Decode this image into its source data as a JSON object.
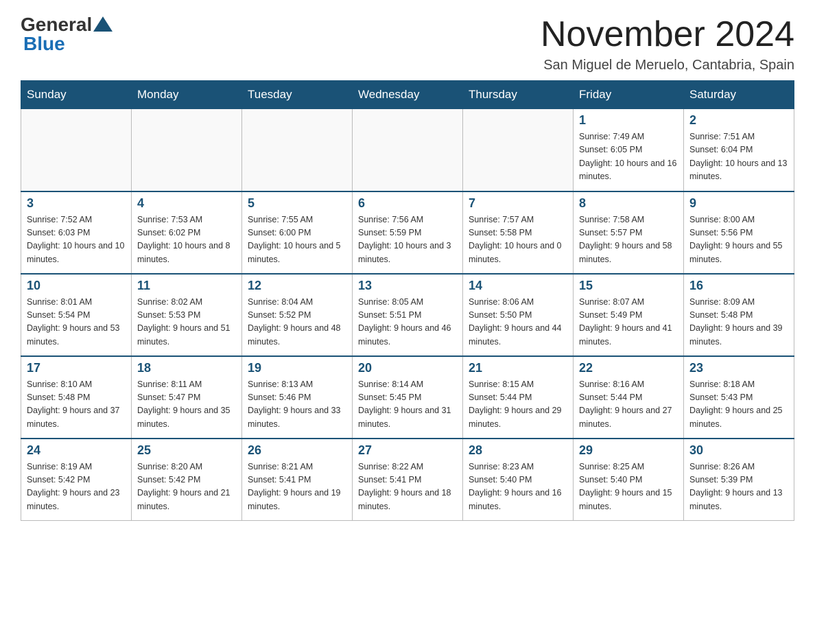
{
  "header": {
    "logo_general": "General",
    "logo_blue": "Blue",
    "month_title": "November 2024",
    "location": "San Miguel de Meruelo, Cantabria, Spain"
  },
  "weekdays": [
    "Sunday",
    "Monday",
    "Tuesday",
    "Wednesday",
    "Thursday",
    "Friday",
    "Saturday"
  ],
  "weeks": [
    [
      {
        "day": "",
        "info": ""
      },
      {
        "day": "",
        "info": ""
      },
      {
        "day": "",
        "info": ""
      },
      {
        "day": "",
        "info": ""
      },
      {
        "day": "",
        "info": ""
      },
      {
        "day": "1",
        "info": "Sunrise: 7:49 AM\nSunset: 6:05 PM\nDaylight: 10 hours and 16 minutes."
      },
      {
        "day": "2",
        "info": "Sunrise: 7:51 AM\nSunset: 6:04 PM\nDaylight: 10 hours and 13 minutes."
      }
    ],
    [
      {
        "day": "3",
        "info": "Sunrise: 7:52 AM\nSunset: 6:03 PM\nDaylight: 10 hours and 10 minutes."
      },
      {
        "day": "4",
        "info": "Sunrise: 7:53 AM\nSunset: 6:02 PM\nDaylight: 10 hours and 8 minutes."
      },
      {
        "day": "5",
        "info": "Sunrise: 7:55 AM\nSunset: 6:00 PM\nDaylight: 10 hours and 5 minutes."
      },
      {
        "day": "6",
        "info": "Sunrise: 7:56 AM\nSunset: 5:59 PM\nDaylight: 10 hours and 3 minutes."
      },
      {
        "day": "7",
        "info": "Sunrise: 7:57 AM\nSunset: 5:58 PM\nDaylight: 10 hours and 0 minutes."
      },
      {
        "day": "8",
        "info": "Sunrise: 7:58 AM\nSunset: 5:57 PM\nDaylight: 9 hours and 58 minutes."
      },
      {
        "day": "9",
        "info": "Sunrise: 8:00 AM\nSunset: 5:56 PM\nDaylight: 9 hours and 55 minutes."
      }
    ],
    [
      {
        "day": "10",
        "info": "Sunrise: 8:01 AM\nSunset: 5:54 PM\nDaylight: 9 hours and 53 minutes."
      },
      {
        "day": "11",
        "info": "Sunrise: 8:02 AM\nSunset: 5:53 PM\nDaylight: 9 hours and 51 minutes."
      },
      {
        "day": "12",
        "info": "Sunrise: 8:04 AM\nSunset: 5:52 PM\nDaylight: 9 hours and 48 minutes."
      },
      {
        "day": "13",
        "info": "Sunrise: 8:05 AM\nSunset: 5:51 PM\nDaylight: 9 hours and 46 minutes."
      },
      {
        "day": "14",
        "info": "Sunrise: 8:06 AM\nSunset: 5:50 PM\nDaylight: 9 hours and 44 minutes."
      },
      {
        "day": "15",
        "info": "Sunrise: 8:07 AM\nSunset: 5:49 PM\nDaylight: 9 hours and 41 minutes."
      },
      {
        "day": "16",
        "info": "Sunrise: 8:09 AM\nSunset: 5:48 PM\nDaylight: 9 hours and 39 minutes."
      }
    ],
    [
      {
        "day": "17",
        "info": "Sunrise: 8:10 AM\nSunset: 5:48 PM\nDaylight: 9 hours and 37 minutes."
      },
      {
        "day": "18",
        "info": "Sunrise: 8:11 AM\nSunset: 5:47 PM\nDaylight: 9 hours and 35 minutes."
      },
      {
        "day": "19",
        "info": "Sunrise: 8:13 AM\nSunset: 5:46 PM\nDaylight: 9 hours and 33 minutes."
      },
      {
        "day": "20",
        "info": "Sunrise: 8:14 AM\nSunset: 5:45 PM\nDaylight: 9 hours and 31 minutes."
      },
      {
        "day": "21",
        "info": "Sunrise: 8:15 AM\nSunset: 5:44 PM\nDaylight: 9 hours and 29 minutes."
      },
      {
        "day": "22",
        "info": "Sunrise: 8:16 AM\nSunset: 5:44 PM\nDaylight: 9 hours and 27 minutes."
      },
      {
        "day": "23",
        "info": "Sunrise: 8:18 AM\nSunset: 5:43 PM\nDaylight: 9 hours and 25 minutes."
      }
    ],
    [
      {
        "day": "24",
        "info": "Sunrise: 8:19 AM\nSunset: 5:42 PM\nDaylight: 9 hours and 23 minutes."
      },
      {
        "day": "25",
        "info": "Sunrise: 8:20 AM\nSunset: 5:42 PM\nDaylight: 9 hours and 21 minutes."
      },
      {
        "day": "26",
        "info": "Sunrise: 8:21 AM\nSunset: 5:41 PM\nDaylight: 9 hours and 19 minutes."
      },
      {
        "day": "27",
        "info": "Sunrise: 8:22 AM\nSunset: 5:41 PM\nDaylight: 9 hours and 18 minutes."
      },
      {
        "day": "28",
        "info": "Sunrise: 8:23 AM\nSunset: 5:40 PM\nDaylight: 9 hours and 16 minutes."
      },
      {
        "day": "29",
        "info": "Sunrise: 8:25 AM\nSunset: 5:40 PM\nDaylight: 9 hours and 15 minutes."
      },
      {
        "day": "30",
        "info": "Sunrise: 8:26 AM\nSunset: 5:39 PM\nDaylight: 9 hours and 13 minutes."
      }
    ]
  ]
}
